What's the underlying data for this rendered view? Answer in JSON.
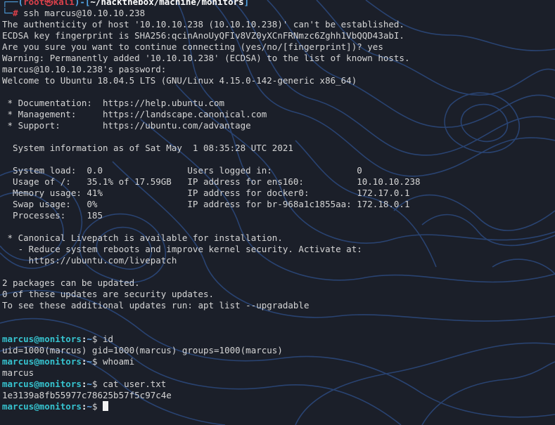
{
  "prompt_top": {
    "user": "root",
    "at": "㉿",
    "host": "kali",
    "path": "~/hackthebox/machine/monitors"
  },
  "session": {
    "root_command": "ssh marcus@10.10.10.238",
    "output_before_motd": [
      "The authenticity of host '10.10.10.238 (10.10.10.238)' can't be established.",
      "ECDSA key fingerprint is SHA256:qcinAnoUyQFIv8VZ0yXCnFRNmzc6Zghh1VbQQD43abI.",
      "Are you sure you want to continue connecting (yes/no/[fingerprint])? yes",
      "Warning: Permanently added '10.10.10.238' (ECDSA) to the list of known hosts.",
      "marcus@10.10.10.238's password:",
      "Welcome to Ubuntu 18.04.5 LTS (GNU/Linux 4.15.0-142-generic x86_64)",
      "",
      " * Documentation:  https://help.ubuntu.com",
      " * Management:     https://landscape.canonical.com",
      " * Support:        https://ubuntu.com/advantage",
      "",
      "  System information as of Sat May  1 08:35:28 UTC 2021",
      "",
      "  System load:  0.0                Users logged in:                0",
      "  Usage of /:   35.1% of 17.59GB   IP address for ens160:          10.10.10.238",
      "  Memory usage: 41%                IP address for docker0:         172.17.0.1",
      "  Swap usage:   0%                 IP address for br-968a1c1855aa: 172.18.0.1",
      "  Processes:    185",
      "",
      " * Canonical Livepatch is available for installation.",
      "   - Reduce system reboots and improve kernel security. Activate at:",
      "     https://ubuntu.com/livepatch",
      "",
      "2 packages can be updated.",
      "0 of these updates are security updates.",
      "To see these additional updates run: apt list --upgradable",
      "",
      ""
    ]
  },
  "remote_prompt": {
    "user_host": "marcus@monitors",
    "path": "~",
    "symbol": "$"
  },
  "remote_session": [
    {
      "command": "id",
      "output": "uid=1000(marcus) gid=1000(marcus) groups=1000(marcus)"
    },
    {
      "command": "whoami",
      "output": "marcus"
    },
    {
      "command": "cat user.txt",
      "output": "1e3139a8fb55977c78625b57f5c97c4e"
    }
  ],
  "theme": {
    "background": "#1b1f29",
    "contour": "#2e4f8a",
    "text": "#d6d6d6",
    "prompt_frame": "#52a7e8",
    "prompt_user": "#d8404a",
    "remote_user": "#36c3cf"
  }
}
